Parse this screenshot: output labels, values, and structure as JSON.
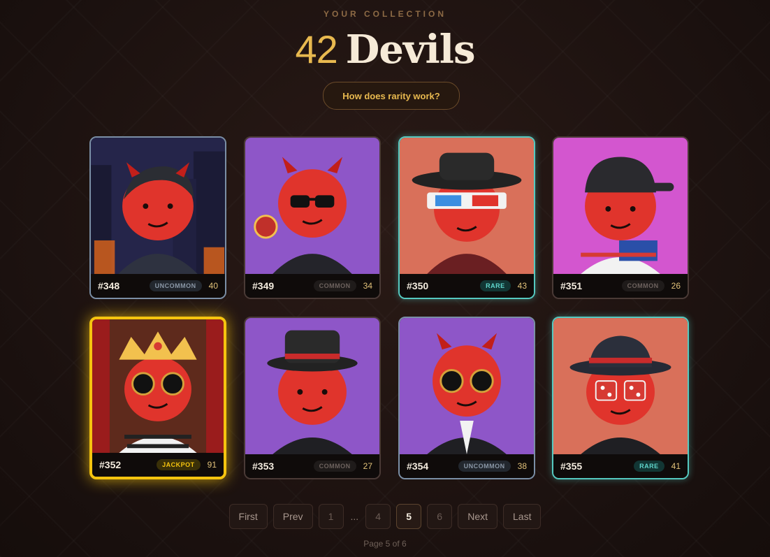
{
  "header": {
    "kicker": "YOUR COLLECTION",
    "count": "42",
    "title_word": "Devils",
    "rarity_button": "How does rarity work?"
  },
  "cards": [
    {
      "id": "#348",
      "rarity": "UNCOMMON",
      "score": "40",
      "bg": "#2a2a4a"
    },
    {
      "id": "#349",
      "rarity": "COMMON",
      "score": "34",
      "bg": "#8e56c8"
    },
    {
      "id": "#350",
      "rarity": "RARE",
      "score": "43",
      "bg": "#d9705a"
    },
    {
      "id": "#351",
      "rarity": "COMMON",
      "score": "26",
      "bg": "#d356cf"
    },
    {
      "id": "#352",
      "rarity": "JACKPOT",
      "score": "91",
      "bg": "#5e2a1c"
    },
    {
      "id": "#353",
      "rarity": "COMMON",
      "score": "27",
      "bg": "#8e56c8"
    },
    {
      "id": "#354",
      "rarity": "UNCOMMON",
      "score": "38",
      "bg": "#8e56c8"
    },
    {
      "id": "#355",
      "rarity": "RARE",
      "score": "41",
      "bg": "#d9705a"
    }
  ],
  "pagination": {
    "first": "First",
    "prev": "Prev",
    "page_1": "1",
    "ellipsis": "...",
    "page_4": "4",
    "page_5": "5",
    "page_6": "6",
    "next": "Next",
    "last": "Last",
    "status": "Page 5 of 6"
  },
  "colors": {
    "accent": "#e8b94f",
    "rare": "#55c9c0",
    "jackpot": "#f5c40f",
    "uncommon": "#7b8fa6"
  }
}
